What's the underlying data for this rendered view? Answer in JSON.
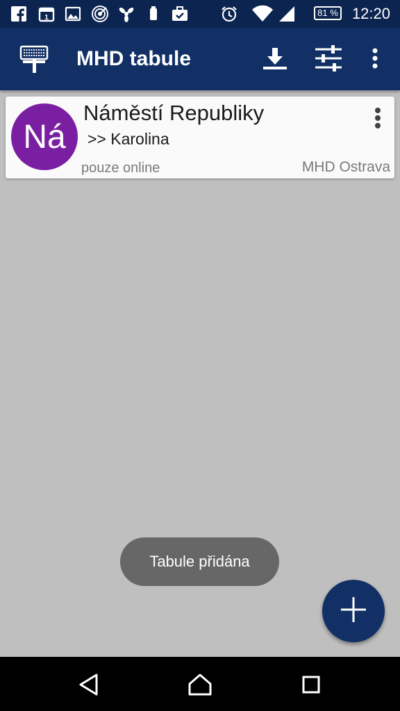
{
  "status_bar": {
    "time": "12:20",
    "battery": "81 %",
    "icons": [
      "facebook-icon",
      "calendar-icon",
      "image-icon",
      "radar-icon",
      "fan-icon",
      "phone-icon",
      "briefcase-check-icon",
      "alarm-icon",
      "wifi-icon",
      "signal-icon"
    ]
  },
  "app_bar": {
    "title": "MHD tabule",
    "icons": [
      "departure-board-icon",
      "download-icon",
      "sliders-icon",
      "more-vert-icon"
    ]
  },
  "boards": [
    {
      "avatar_text": "Ná",
      "avatar_color": "#7b1fa2",
      "stop_name": "Náměstí Republiky",
      "direction": ">> Karolina",
      "mode": "pouze online",
      "network": "MHD Ostrava"
    }
  ],
  "toast": {
    "text": "Tabule přidána"
  },
  "fab": {
    "icon": "add-icon",
    "color": "#123066"
  },
  "nav_bar": {
    "icons": [
      "back-icon",
      "home-icon",
      "recents-icon"
    ]
  },
  "colors": {
    "primary": "#123066",
    "status_bar": "#0c2450",
    "background": "#bfbfbf"
  }
}
